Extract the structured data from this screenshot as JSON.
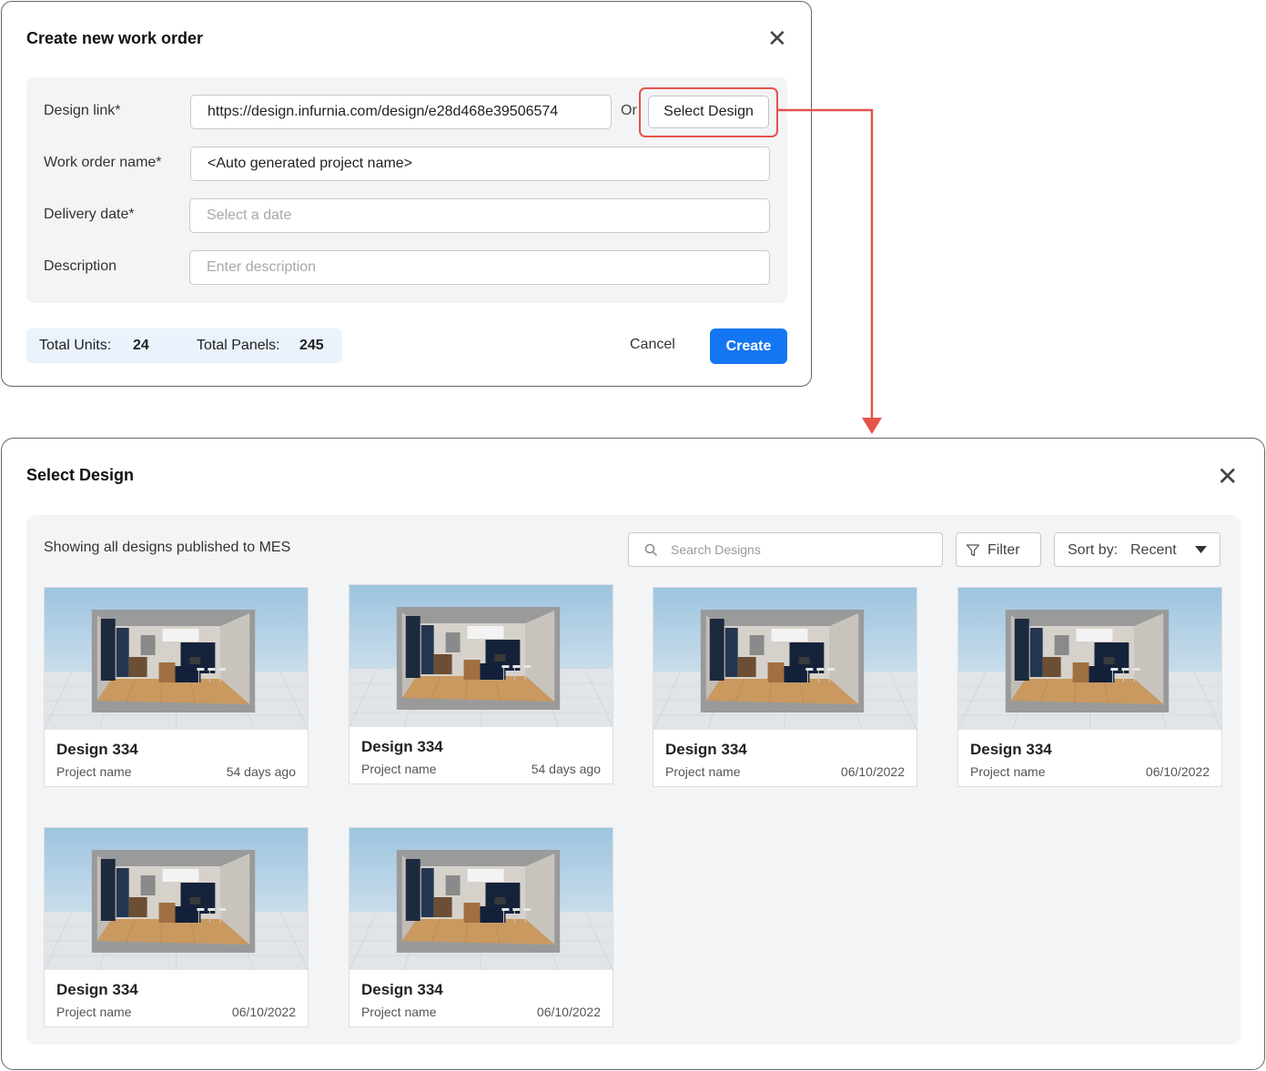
{
  "work_order_modal": {
    "title": "Create new work order",
    "close_icon": "close-icon",
    "fields": {
      "design_link": {
        "label": "Design link*",
        "value": "https://design.infurnia.com/design/e28d468e39506574"
      },
      "or_text": "Or",
      "select_design_label": "Select Design",
      "work_order_name": {
        "label": "Work order name*",
        "value": "<Auto generated project name>"
      },
      "delivery_date": {
        "label": "Delivery date*",
        "placeholder": "Select a date"
      },
      "description": {
        "label": "Description",
        "placeholder": "Enter description"
      }
    },
    "totals": {
      "units_label": "Total Units:",
      "units_value": "24",
      "panels_label": "Total Panels:",
      "panels_value": "245"
    },
    "cancel_label": "Cancel",
    "create_label": "Create"
  },
  "select_design_modal": {
    "title": "Select Design",
    "close_icon": "close-icon",
    "caption": "Showing all designs published to MES",
    "search": {
      "placeholder": "Search Designs",
      "icon": "search-icon"
    },
    "filter_label": "Filter",
    "sort": {
      "label": "Sort by:",
      "value": "Recent"
    },
    "cards": [
      {
        "title": "Design 334",
        "subtitle": "Project name",
        "date": "54 days ago"
      },
      {
        "title": "Design 334",
        "subtitle": "Project name",
        "date": "54 days ago"
      },
      {
        "title": "Design 334",
        "subtitle": "Project name",
        "date": "06/10/2022"
      },
      {
        "title": "Design 334",
        "subtitle": "Project name",
        "date": "06/10/2022"
      },
      {
        "title": "Design 334",
        "subtitle": "Project name",
        "date": "06/10/2022"
      },
      {
        "title": "Design 334",
        "subtitle": "Project name",
        "date": "06/10/2022"
      }
    ]
  },
  "colors": {
    "primary": "#1476f2",
    "highlight": "#e5534b",
    "panel_bg": "#f3f4f6",
    "totals_bg": "#eaf2fb"
  }
}
